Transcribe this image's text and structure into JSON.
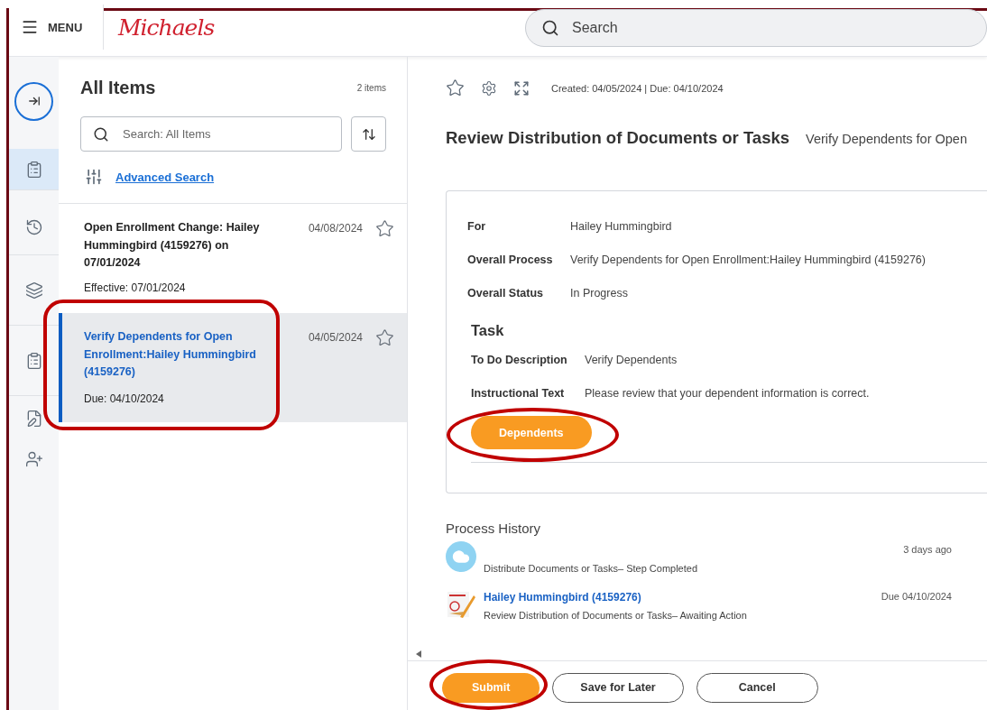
{
  "header": {
    "menu_label": "MENU",
    "logo": "Michaels",
    "search": {
      "placeholder": "Search"
    }
  },
  "rail": [
    {
      "kind": "collapse",
      "selected": false
    },
    {
      "kind": "clipboard",
      "selected": true
    },
    {
      "kind": "clock",
      "selected": false
    },
    {
      "kind": "layers",
      "selected": false
    },
    {
      "kind": "clipboard",
      "selected": false
    },
    {
      "kind": "edit",
      "selected": false
    },
    {
      "kind": "user-add",
      "selected": false
    }
  ],
  "list": {
    "title": "All Items",
    "count": "2 items",
    "search": {
      "placeholder": "Search: All Items"
    },
    "advanced_search": "Advanced Search",
    "items": [
      {
        "title": "Open Enrollment Change: Hailey Hummingbird (4159276) on 07/01/2024",
        "date": "04/08/2024",
        "meta": "Effective: 07/01/2024",
        "selected": false,
        "highlighted": false
      },
      {
        "title": "Verify Dependents for Open Enrollment:Hailey Hummingbird (4159276)",
        "date": "04/05/2024",
        "meta": "Due: 04/10/2024",
        "selected": true,
        "highlighted": true
      }
    ]
  },
  "detail": {
    "dates": "Created: 04/05/2024 | Due: 04/10/2024",
    "title": "Review Distribution of Documents or Tasks",
    "subtitle": "Verify Dependents for Open",
    "fields": [
      {
        "label": "For",
        "value": "Hailey Hummingbird"
      },
      {
        "label": "Overall Process",
        "value": "Verify Dependents for Open Enrollment:Hailey Hummingbird (4159276)"
      },
      {
        "label": "Overall Status",
        "value": "In Progress"
      }
    ],
    "task": {
      "heading": "Task",
      "fields": [
        {
          "label": "To Do Description",
          "value": "Verify Dependents"
        },
        {
          "label": "Instructional Text",
          "value": "Please review that your dependent information is correct."
        }
      ],
      "button": {
        "label": "Dependents",
        "highlighted": true
      }
    },
    "history": {
      "heading": "Process History",
      "entries": [
        {
          "kind": "cloud",
          "description": "Distribute Documents or Tasks– Step Completed",
          "when": "3 days ago"
        },
        {
          "kind": "picture",
          "name": "Hailey Hummingbird (4159276)",
          "description": "Review Distribution of Documents or Tasks– Awaiting Action",
          "when": "Due 04/10/2024"
        }
      ]
    }
  },
  "footer": [
    {
      "kind": "primary",
      "label": "Submit",
      "highlighted": true
    },
    {
      "kind": "secondary",
      "label": "Save for Later",
      "highlighted": false
    },
    {
      "kind": "secondary",
      "label": "Cancel",
      "highlighted": false
    }
  ]
}
